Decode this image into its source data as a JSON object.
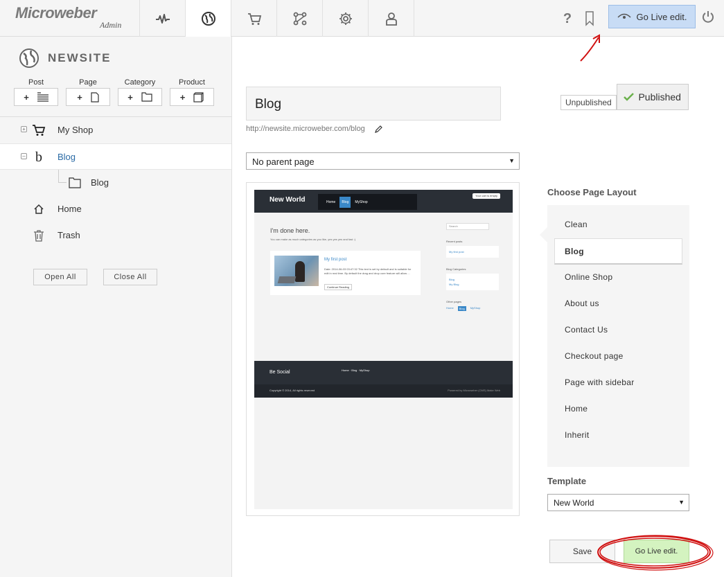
{
  "header": {
    "logo": "Microweber",
    "logo_sub": "Admin",
    "nav_icons": [
      "activity-icon",
      "globe-icon",
      "cart-icon",
      "modules-icon",
      "gear-icon",
      "user-icon"
    ],
    "help_icon": "question-icon",
    "bookmark_icon": "bookmark-icon",
    "golive_label": "Go Live edit.",
    "power_icon": "power-icon"
  },
  "sidebar": {
    "site_name": "NEWSITE",
    "add_buttons": [
      {
        "label": "Post",
        "icon": "post-list-icon"
      },
      {
        "label": "Page",
        "icon": "page-icon"
      },
      {
        "label": "Category",
        "icon": "folder-icon"
      },
      {
        "label": "Product",
        "icon": "product-icon"
      }
    ],
    "add_symbol": "+",
    "tree": [
      {
        "label": "My Shop",
        "icon": "cart-icon",
        "toggle": "+"
      },
      {
        "label": "Blog",
        "icon": "b-icon",
        "toggle": "–"
      },
      {
        "label": "Blog",
        "icon": "folder-icon"
      },
      {
        "label": "Home",
        "icon": "home-icon"
      },
      {
        "label": "Trash",
        "icon": "trash-icon"
      }
    ],
    "open_all": "Open All",
    "close_all": "Close All"
  },
  "main": {
    "title": "Blog",
    "url": "http://newsite.microweber.com/blog",
    "unpublished": "Unpublished",
    "published": "Published",
    "parent_select": "No parent page",
    "preview": {
      "brand": "New World",
      "nav": [
        "Home",
        "Blog",
        "MyShop"
      ],
      "cart": "Your cart is empty",
      "heading": "I'm done here.",
      "sub": "You can make as much categories as you like, yes yes yes and fast :)",
      "post_title": "My first post",
      "post_meta": "Date: 2014-06-03 03:47:32 This text is set by default and is suitable for edit in real time. By default the drag and drop core feature will allow ...",
      "post_more": "Continue Reading",
      "search": "Search",
      "recent_posts": "Recent posts",
      "blog_categories": "Blog Categories",
      "categories": [
        "Blog",
        "My Blog"
      ],
      "other_pages": "Other pages",
      "other_links": [
        "Home",
        "Blog",
        "MyShop"
      ],
      "be_social": "Be Social",
      "footer_links": "Home · Blog · MyShop",
      "copyright": "Copyright © 2014, All rights reserved",
      "powered": "Powered by Microweber (CMS) Make Web"
    },
    "layout_title": "Choose Page Layout",
    "layouts": [
      "Clean",
      "Blog",
      "Online Shop",
      "About us",
      "Contact Us",
      "Checkout page",
      "Page with sidebar",
      "Home",
      "Inherit"
    ],
    "layout_selected": "Blog",
    "template_title": "Template",
    "template_value": "New World",
    "save": "Save",
    "golive": "Go Live edit."
  }
}
